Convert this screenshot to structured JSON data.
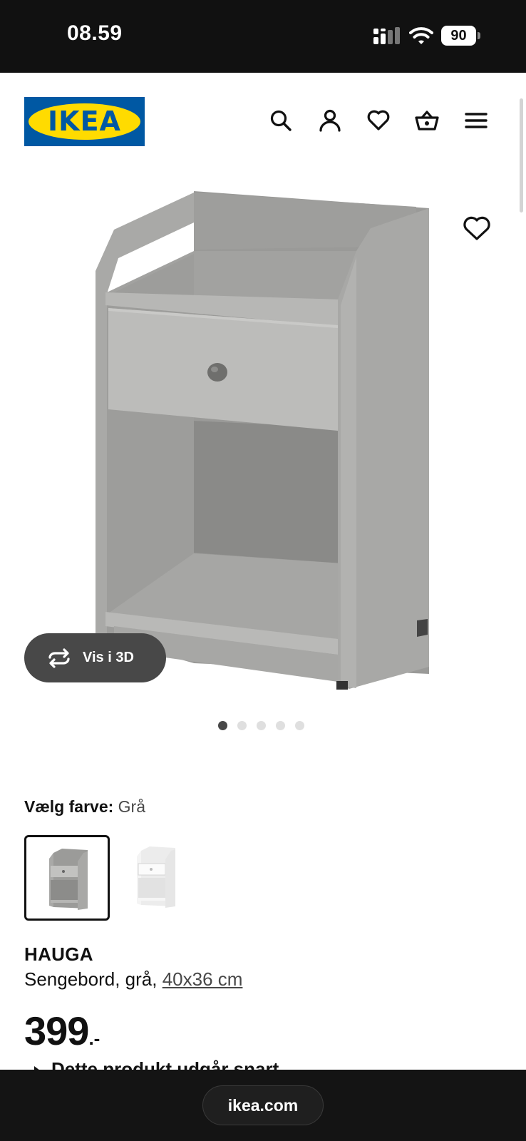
{
  "status_bar": {
    "time": "08.59",
    "battery_level": "90",
    "icons": [
      "signal-icon",
      "wifi-icon",
      "battery-icon"
    ]
  },
  "header": {
    "logo_text": "IKEA",
    "icons": [
      "search-icon",
      "account-icon",
      "wishlist-icon",
      "cart-icon",
      "menu-icon"
    ]
  },
  "gallery": {
    "view_3d_label": "Vis i 3D",
    "image_count": 5,
    "active_index": 0
  },
  "color_selector": {
    "label": "Vælg farve:",
    "selected_value": "Grå",
    "options": [
      "grey",
      "white"
    ]
  },
  "product": {
    "name": "HAUGA",
    "description": "Sengebord, grå,",
    "size_link": "40x36 cm",
    "price": "399",
    "price_suffix": ".-",
    "notice": "Dette produkt udgår snart"
  },
  "browser": {
    "url": "ikea.com"
  },
  "colors": {
    "brand_blue": "#0058a3",
    "brand_yellow": "#ffdb00",
    "bar_dark": "#111111",
    "button_dark": "#484848"
  }
}
